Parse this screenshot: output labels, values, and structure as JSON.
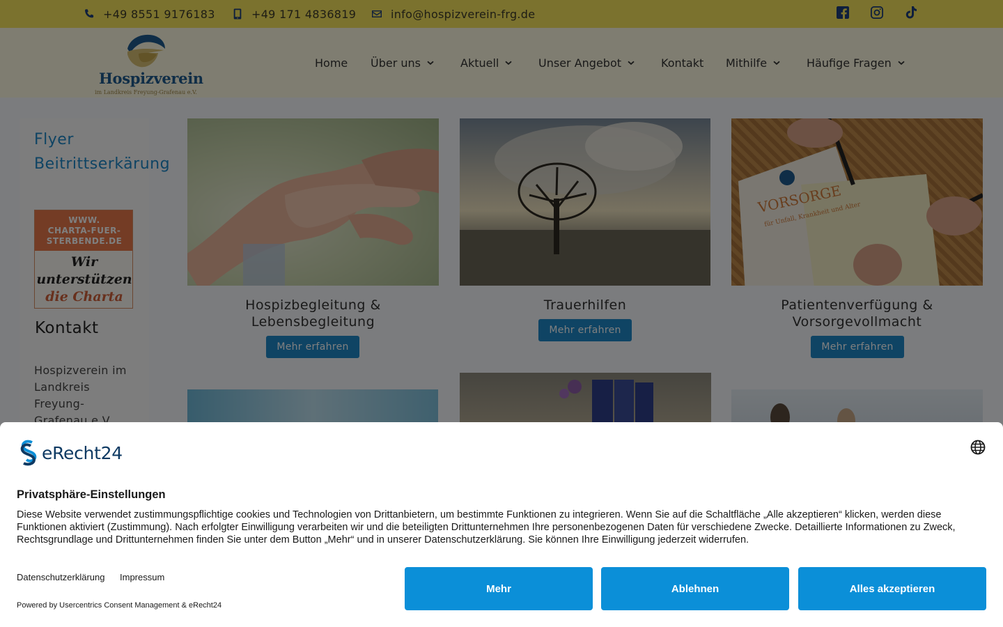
{
  "topbar": {
    "phone": "+49 8551 9176183",
    "mobile": "+49 171 4836819",
    "email": "info@hospizverein-frg.de",
    "social_icons": [
      "facebook-icon",
      "instagram-icon",
      "tiktok-icon"
    ]
  },
  "header": {
    "logo_title": "Hospizverein",
    "logo_subtitle": "im Landkreis Freyung-Grafenau e.V.",
    "nav": [
      {
        "label": "Home",
        "has_dropdown": false
      },
      {
        "label": "Über uns",
        "has_dropdown": true
      },
      {
        "label": "Aktuell",
        "has_dropdown": true
      },
      {
        "label": "Unser Angebot",
        "has_dropdown": true
      },
      {
        "label": "Kontakt",
        "has_dropdown": false
      },
      {
        "label": "Mithilfe",
        "has_dropdown": true
      },
      {
        "label": "Häufige Fragen",
        "has_dropdown": true
      }
    ]
  },
  "sidebar": {
    "links": [
      "Flyer",
      "Beitrittserkärung"
    ],
    "charta_banner": {
      "url_lines": [
        "WWW.",
        "CHARTA-FUER-",
        "STERBENDE.DE"
      ],
      "slogan_lines": [
        "Wir",
        "unterstützen",
        "die Charta"
      ]
    },
    "contact_heading": "Kontakt",
    "address_lines": [
      "Hospizverein im",
      "Landkreis",
      "Freyung-",
      "Grafenau e.V."
    ]
  },
  "cards": [
    {
      "title_lines": [
        "Hospizbegleitung &",
        "Lebensbegleitung"
      ],
      "button": "Mehr erfahren"
    },
    {
      "title_lines": [
        "Trauerhilfen"
      ],
      "button": "Mehr erfahren"
    },
    {
      "title_lines": [
        "Patientenverfügung &",
        "Vorsorgevollmacht"
      ],
      "button": "Mehr erfahren"
    }
  ],
  "card_image_text": {
    "document_heading": "VORSORGE",
    "document_sub": "für Unfall, Krankheit und Alter"
  },
  "consent": {
    "brand": "eRecht24",
    "title": "Privatsphäre-Einstellungen",
    "text": "Diese Website verwendet zustimmungspflichtige cookies und Technologien von Drittanbietern, um bestimmte Funktionen zu integrieren. Wenn Sie auf die Schaltfläche „Alle akzeptieren“ klicken, werden diese Funktionen aktiviert (Zustimmung). Nach erfolgter Einwilligung verarbeiten wir und die beteiligten Drittunternehmen Ihre personenbezogenen Daten für verschiedene Zwecke. Detaillierte Informationen zu Zweck, Rechtsgrundlage und Drittunternehmen finden Sie unter dem Button „Mehr“ und in unserer Datenschutzerklärung. Sie können Ihre Einwilligung jederzeit widerrufen.",
    "links": [
      "Datenschutzerklärung",
      "Impressum"
    ],
    "powered_by": "Powered by Usercentrics Consent Management & eRecht24",
    "buttons": [
      "Mehr",
      "Ablehnen",
      "Alles akzeptieren"
    ]
  },
  "colors": {
    "topbar_bg": "#f6e55c",
    "header_bg": "#fffbe3",
    "icon_blue": "#1f3f7a",
    "link_blue": "#1f89c8",
    "consent_button": "#0b8fd8"
  }
}
